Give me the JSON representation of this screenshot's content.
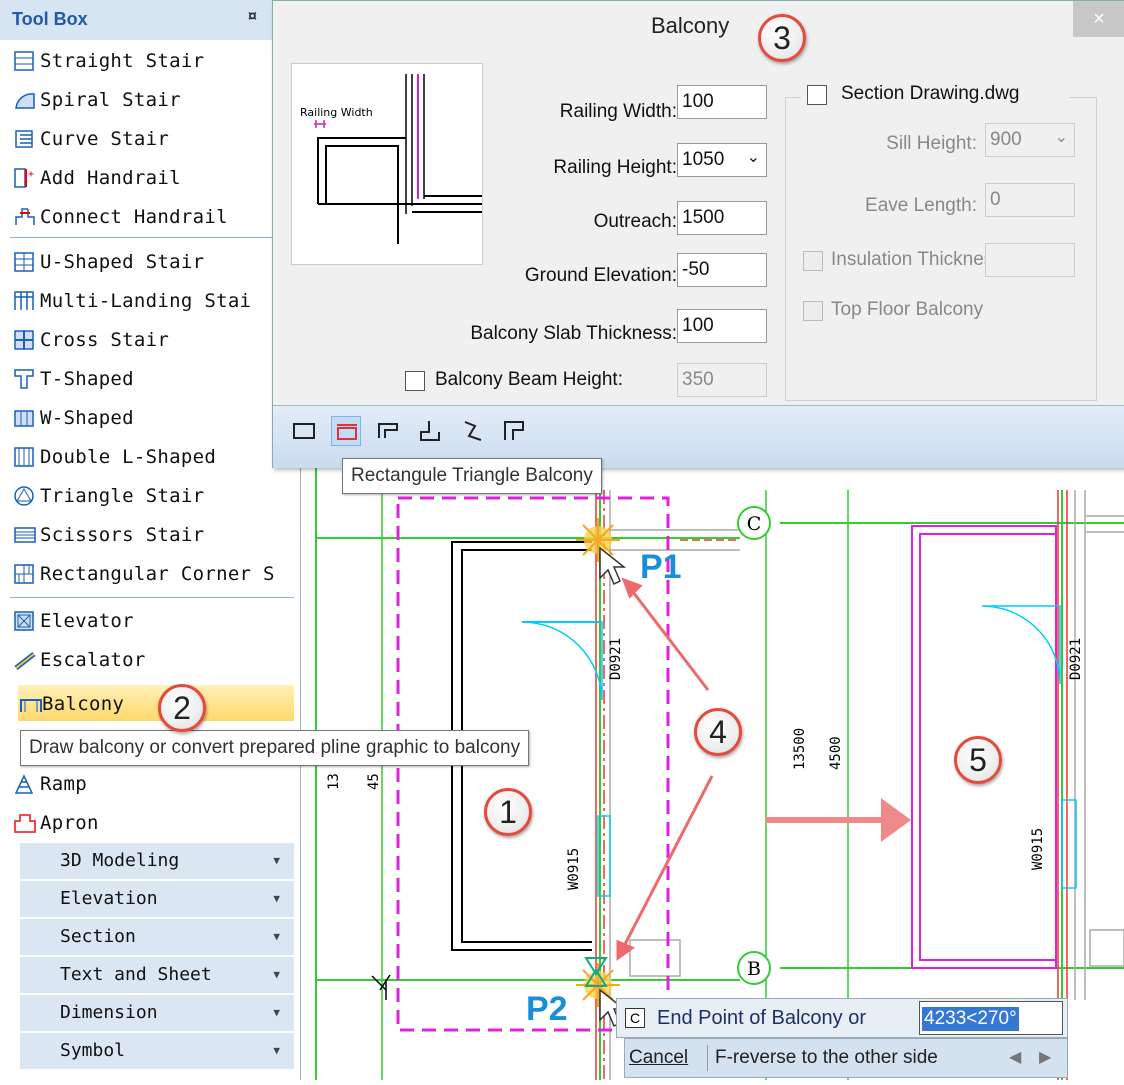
{
  "toolbox": {
    "title": "Tool Box",
    "pin": "¤",
    "items": [
      {
        "label": "Straight Stair"
      },
      {
        "label": "Spiral Stair"
      },
      {
        "label": "Curve Stair"
      },
      {
        "label": "Add Handrail"
      },
      {
        "label": "Connect Handrail"
      },
      {
        "label": "U-Shaped Stair"
      },
      {
        "label": "Multi-Landing Stai"
      },
      {
        "label": "Cross Stair"
      },
      {
        "label": "T-Shaped"
      },
      {
        "label": "W-Shaped"
      },
      {
        "label": "Double L-Shaped"
      },
      {
        "label": "Triangle Stair"
      },
      {
        "label": "Scissors Stair"
      },
      {
        "label": "Rectangular Corner S"
      },
      {
        "label": "Elevator"
      },
      {
        "label": "Escalator"
      },
      {
        "label": "Balcony"
      },
      {
        "label": "Ramp"
      },
      {
        "label": "Apron"
      }
    ],
    "categories": [
      "3D Modeling",
      "Elevation",
      "Section",
      "Text and Sheet",
      "Dimension",
      "Symbol"
    ],
    "balcony_tooltip": "Draw balcony or convert prepared pline graphic to balcony"
  },
  "dialog": {
    "title": "Balcony",
    "close": "×",
    "preview_label": "Railing Width",
    "fields": {
      "railing_width": {
        "label": "Railing Width:",
        "value": "100"
      },
      "railing_height": {
        "label": "Railing Height:",
        "value": "1050"
      },
      "outreach": {
        "label": "Outreach:",
        "value": "1500"
      },
      "ground_elevation": {
        "label": "Ground Elevation:",
        "value": "-50"
      },
      "slab_thickness": {
        "label": "Balcony Slab Thickness:",
        "value": "100"
      },
      "beam_height": {
        "label": "Balcony Beam Height:",
        "value": "350"
      }
    },
    "section": {
      "checkbox_label": "Section Drawing.dwg",
      "sill_height": {
        "label": "Sill Height:",
        "value": "900"
      },
      "eave_length": {
        "label": "Eave Length:",
        "value": "0"
      },
      "insulation_thickness": {
        "label": "Insulation Thickness:"
      },
      "top_floor_balcony": {
        "label": "Top Floor Balcony"
      }
    },
    "toolbar_tooltip": "Rectangule Triangle Balcony"
  },
  "drawing": {
    "axis_c": "C",
    "axis_b": "B",
    "door_label": "D0921",
    "window_label": "W0915",
    "dim_1": "13500",
    "dim_2": "4500",
    "dim_left_1": "13",
    "dim_left_2": "45",
    "p1": "P1",
    "p2": "P2"
  },
  "badges": [
    "1",
    "2",
    "3",
    "4",
    "5"
  ],
  "command": {
    "icon": "C",
    "prompt": "End Point of Balcony or",
    "input_value": "4233<270°",
    "cancel": "Cancel",
    "reverse": "F-reverse to the other side"
  }
}
